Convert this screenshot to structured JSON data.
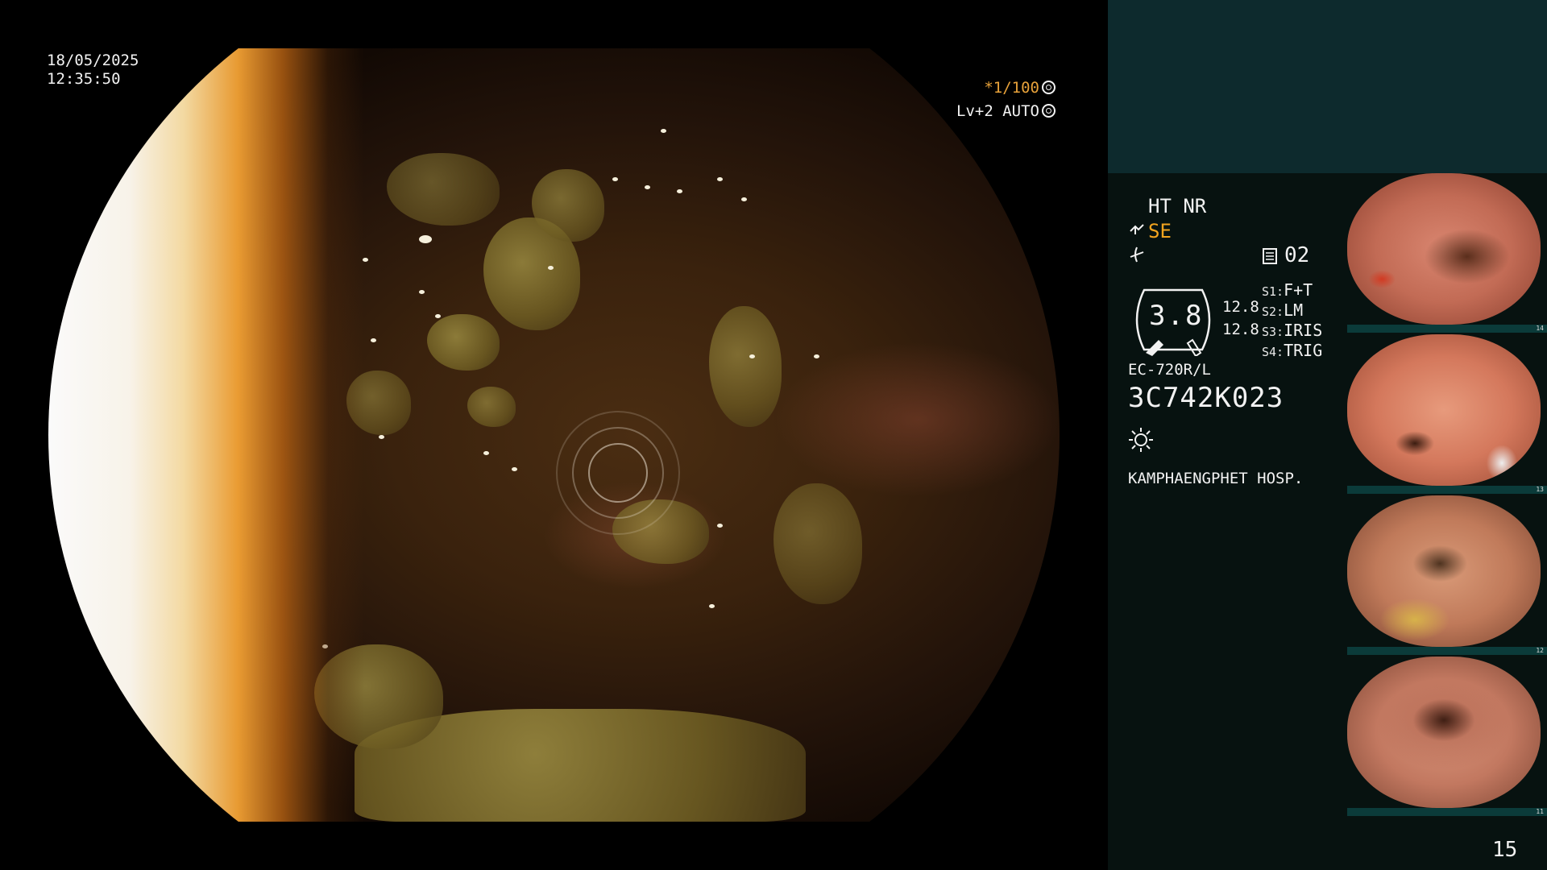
{
  "datetime": {
    "date": "18/05/2025",
    "time": "12:35:50"
  },
  "scope_overlay": {
    "shutter": "*1/100",
    "shutter_icon": "aperture-icon",
    "level": "Lv+2 AUTO",
    "level_icon": "iris-icon"
  },
  "panel": {
    "mode": "HT NR",
    "enhancement": "SE",
    "memory_count": "02",
    "dial_value": "3.8",
    "dial_side_values": [
      "12.8",
      "12.8"
    ],
    "switches": [
      {
        "label": "S1:",
        "value": "F+T"
      },
      {
        "label": "S2:",
        "value": "LM"
      },
      {
        "label": "S3:",
        "value": "IRIS"
      },
      {
        "label": "S4:",
        "value": "TRIG"
      }
    ],
    "scope_model": "EC-720R/L",
    "scope_serial": "3C742K023",
    "hospital": "KAMPHAENGPHET HOSP."
  },
  "thumbnails": [
    {
      "index": "14",
      "description": "captured-frame-1"
    },
    {
      "index": "13",
      "description": "captured-frame-2"
    },
    {
      "index": "12",
      "description": "captured-frame-3"
    },
    {
      "index": "11",
      "description": "captured-frame-4"
    }
  ],
  "page_number": "15",
  "colors": {
    "accent_orange": "#f3a41f",
    "panel_top": "#0d2a2d",
    "panel_bottom": "#071210",
    "thumb_strip": "#0b3b3a"
  }
}
